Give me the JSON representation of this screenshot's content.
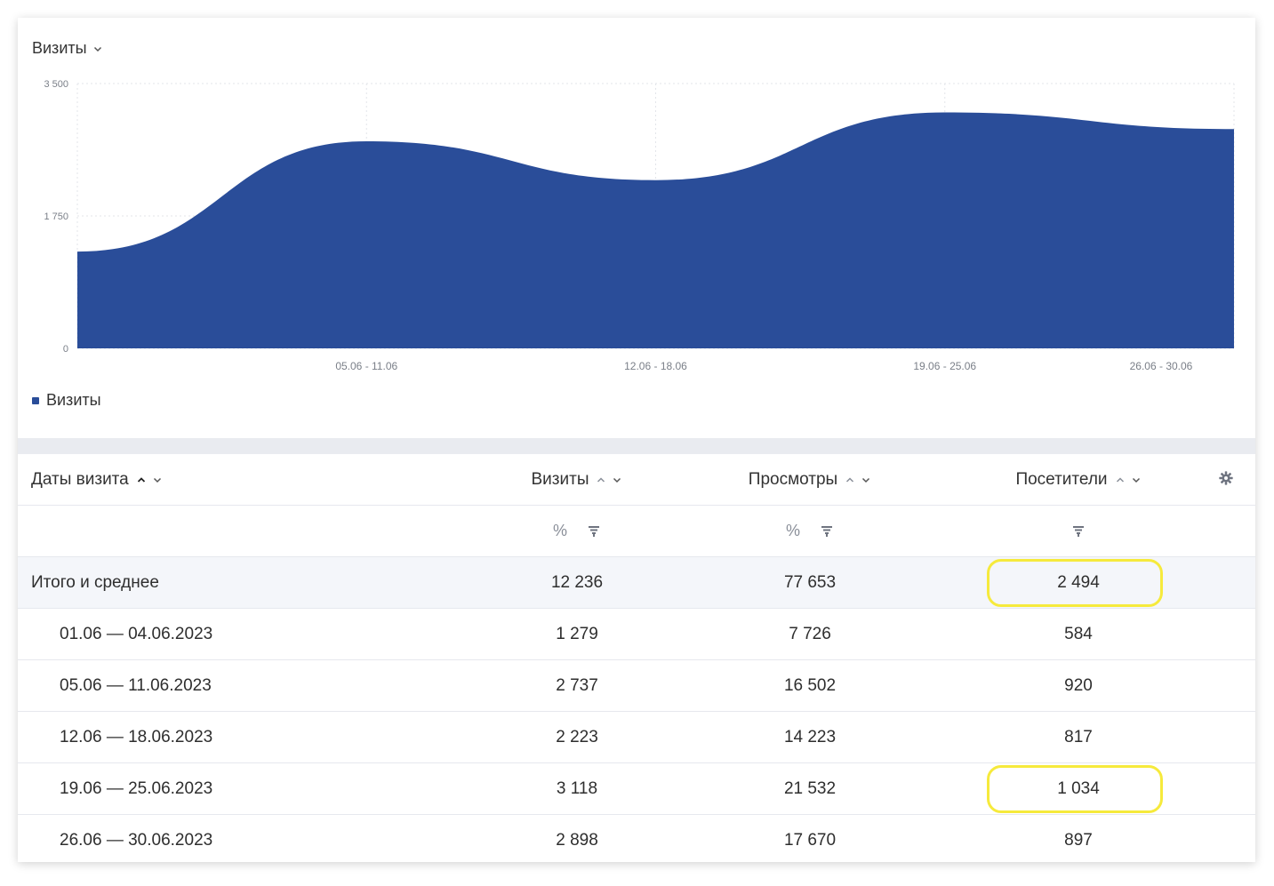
{
  "chart": {
    "metric_selector": "Визиты",
    "legend": "Визиты",
    "colors": {
      "series": "#2a4d99",
      "grid": "#e3e5ea"
    }
  },
  "chart_data": {
    "type": "area",
    "x": [
      "01.06 - 04.06",
      "05.06 - 11.06",
      "12.06 - 18.06",
      "19.06 - 25.06",
      "26.06 - 30.06"
    ],
    "x_tick_labels": [
      "05.06 - 11.06",
      "12.06 - 18.06",
      "19.06 - 25.06",
      "26.06 - 30.06"
    ],
    "y_tick_labels": [
      "3 500",
      "1 750",
      "0"
    ],
    "y_ticks": [
      3500,
      1750,
      0
    ],
    "ylim": [
      0,
      3500
    ],
    "series": [
      {
        "name": "Визиты",
        "values": [
          1279,
          2737,
          2223,
          3118,
          2898
        ]
      }
    ],
    "grid": true,
    "legend_position": "bottom-left"
  },
  "table": {
    "headers": {
      "date": "Даты визита",
      "visits": "Визиты",
      "views": "Просмотры",
      "visitors": "Посетители"
    },
    "percent_symbol": "%",
    "total": {
      "label": "Итого и среднее",
      "visits": "12 236",
      "views": "77 653",
      "visitors": "2 494"
    },
    "rows": [
      {
        "date": "01.06 — 04.06.2023",
        "visits": "1 279",
        "views": "7 726",
        "visitors": "584"
      },
      {
        "date": "05.06 — 11.06.2023",
        "visits": "2 737",
        "views": "16 502",
        "visitors": "920"
      },
      {
        "date": "12.06 — 18.06.2023",
        "visits": "2 223",
        "views": "14 223",
        "visitors": "817"
      },
      {
        "date": "19.06 — 25.06.2023",
        "visits": "3 118",
        "views": "21 532",
        "visitors": "1 034"
      },
      {
        "date": "26.06 — 30.06.2023",
        "visits": "2 898",
        "views": "17 670",
        "visitors": "897"
      }
    ],
    "highlight_color": "#f6ea3c"
  }
}
